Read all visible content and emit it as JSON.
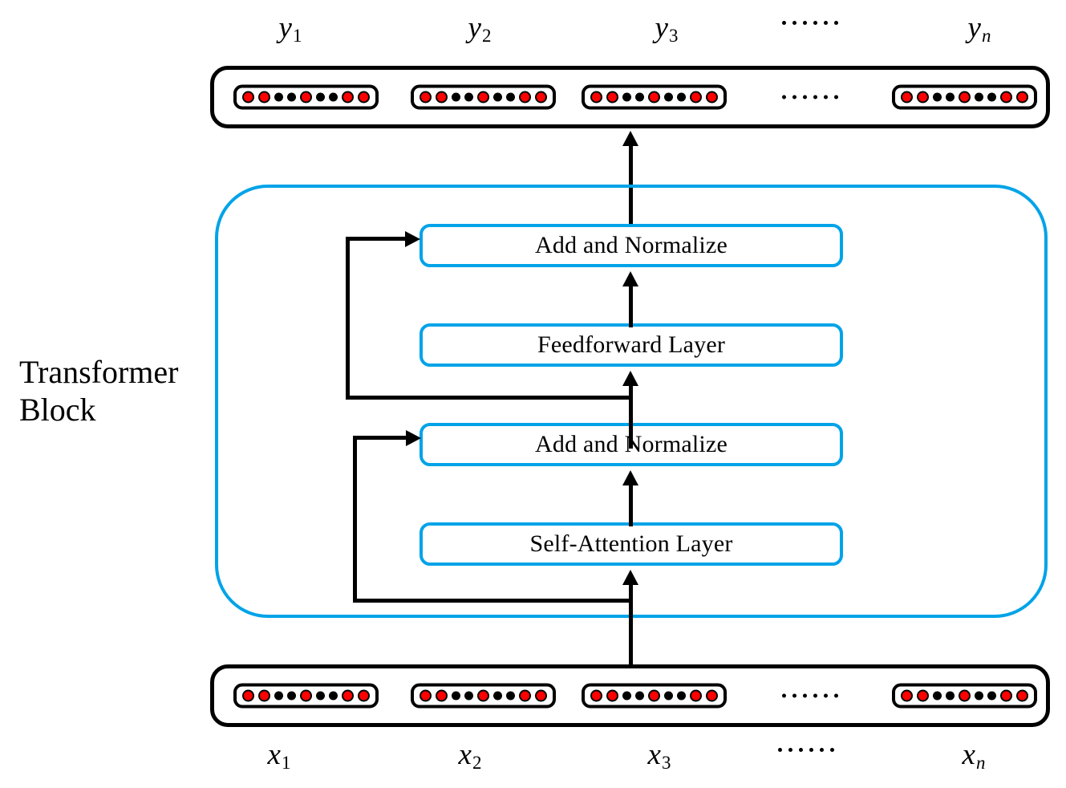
{
  "diagram": {
    "title": "Transformer Block",
    "block_caption": "Transformer\nBlock",
    "block_caption_line1": "Transformer",
    "block_caption_line2": "Block",
    "colors": {
      "accent_blue": "#00A3E8",
      "node_red": "#FF0000",
      "node_black": "#000000",
      "stroke_black": "#000000",
      "background": "#FFFFFF"
    }
  },
  "output_row": {
    "name": "output-embeddings",
    "labels": [
      {
        "base": "y",
        "sub": "1",
        "sub_italic": false
      },
      {
        "base": "y",
        "sub": "2",
        "sub_italic": false
      },
      {
        "base": "y",
        "sub": "3",
        "sub_italic": false
      },
      {
        "base": "",
        "sub": "",
        "ellipsis": true
      },
      {
        "base": "y",
        "sub": "n",
        "sub_italic": true
      }
    ],
    "vector_pattern": [
      "on",
      "on",
      "off",
      "off",
      "on",
      "off",
      "off",
      "on",
      "on"
    ],
    "ellipsis_dots": 6
  },
  "input_row": {
    "name": "input-embeddings",
    "labels": [
      {
        "base": "x",
        "sub": "1",
        "sub_italic": false
      },
      {
        "base": "x",
        "sub": "2",
        "sub_italic": false
      },
      {
        "base": "x",
        "sub": "3",
        "sub_italic": false
      },
      {
        "base": "",
        "sub": "",
        "ellipsis": true
      },
      {
        "base": "x",
        "sub": "n",
        "sub_italic": true
      }
    ],
    "vector_pattern": [
      "on",
      "on",
      "off",
      "off",
      "on",
      "off",
      "off",
      "on",
      "on"
    ],
    "ellipsis_dots": 6
  },
  "layers": [
    {
      "id": "box-addnorm-2",
      "label": "Add and Normalize"
    },
    {
      "id": "box-feedforward",
      "label": "Feedforward Layer"
    },
    {
      "id": "box-addnorm-1",
      "label": "Add and Normalize"
    },
    {
      "id": "box-selfattn",
      "label": "Self-Attention Layer"
    }
  ],
  "connections": [
    {
      "name": "input-to-selfattention",
      "type": "arrow-up"
    },
    {
      "name": "selfattention-to-addnorm-1",
      "type": "arrow-up"
    },
    {
      "name": "residual-skip-1",
      "type": "elbow-arrow-right"
    },
    {
      "name": "addnorm-1-to-feedforward",
      "type": "arrow-up"
    },
    {
      "name": "feedforward-to-addnorm-2",
      "type": "arrow-up"
    },
    {
      "name": "residual-skip-2",
      "type": "elbow-arrow-right"
    },
    {
      "name": "addnorm-2-to-output",
      "type": "arrow-up"
    }
  ]
}
